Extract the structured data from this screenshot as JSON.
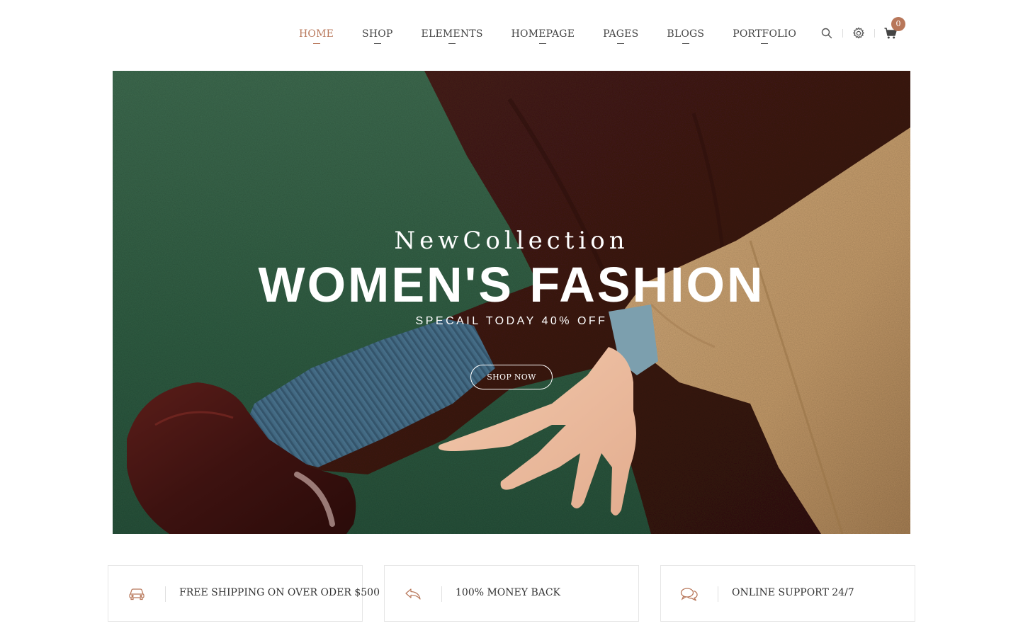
{
  "colors": {
    "accent": "#b8775a",
    "nav_text": "#444444",
    "hero_bg": "#2d5a40"
  },
  "nav": {
    "items": [
      {
        "label": "HOME",
        "active": true
      },
      {
        "label": "SHOP",
        "active": false
      },
      {
        "label": "ELEMENTS",
        "active": false
      },
      {
        "label": "HOMEPAGE",
        "active": false
      },
      {
        "label": "PAGES",
        "active": false
      },
      {
        "label": "BLOGS",
        "active": false
      },
      {
        "label": "PORTFOLIO",
        "active": false
      }
    ]
  },
  "header_icons": {
    "search": "search-icon",
    "settings": "gear-icon",
    "cart": "cart-icon",
    "cart_count": "0"
  },
  "hero": {
    "subtitle": "NewCollection",
    "title": "WOMEN'S FASHION",
    "offer": "SPECAIL TODAY 40% OFF",
    "button_label": "SHOP NOW"
  },
  "features": [
    {
      "icon": "car-icon",
      "label": "FREE SHIPPING ON OVER ODER $500"
    },
    {
      "icon": "reply-icon",
      "label": "100% MONEY BACK"
    },
    {
      "icon": "chat-bubbles-icon",
      "label": "ONLINE SUPPORT 24/7"
    }
  ]
}
